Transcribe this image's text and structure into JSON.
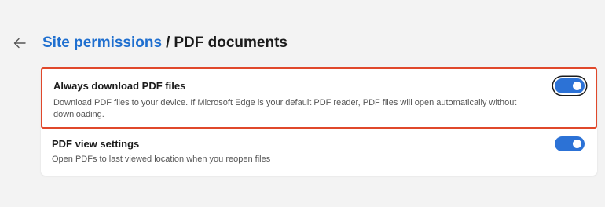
{
  "header": {
    "back_icon": "arrow-left-icon",
    "breadcrumb_parent": "Site permissions",
    "separator": "/",
    "breadcrumb_current": "PDF documents"
  },
  "settings": [
    {
      "title": "Always download PDF files",
      "description": "Download PDF files to your device. If Microsoft Edge is your default PDF reader, PDF files will open automatically without downloading.",
      "enabled": true,
      "highlighted": true
    },
    {
      "title": "PDF view settings",
      "description": "Open PDFs to last viewed location when you reopen files",
      "enabled": true,
      "highlighted": false
    }
  ],
  "colors": {
    "accent": "#2c72d6",
    "link": "#1f6fcf",
    "highlight_border": "#e0482b",
    "background": "#f3f3f3",
    "card": "#ffffff"
  }
}
